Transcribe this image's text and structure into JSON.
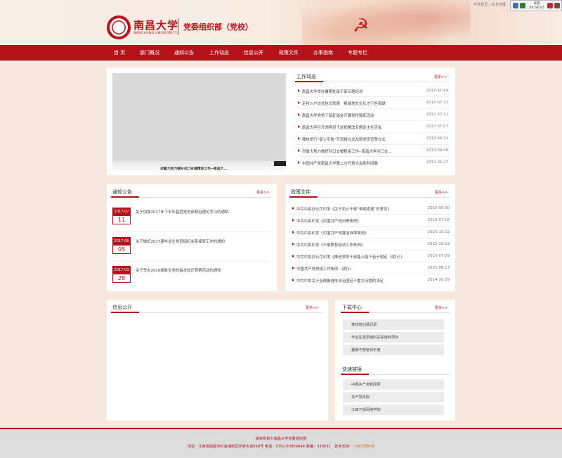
{
  "header": {
    "toplinks": [
      "学校首页",
      "后台管理"
    ],
    "clock_label": "日历",
    "clock_time": "04:58:57",
    "logo_cn": "南昌大学",
    "logo_en": "NANCHANG UNIVERSITY",
    "dept_title": "党委组织部（党校）"
  },
  "nav": [
    "首 页",
    "部门概况",
    "通知公告",
    "工作动态",
    "信息公开",
    "政策文件",
    "办事指南",
    "专题专栏"
  ],
  "more_label": "更多>>",
  "slideshow": {
    "caption": "对暑大努力做好对口支援精金工作--南昌大..."
  },
  "work_news": {
    "title": "工作动态",
    "items": [
      {
        "text": "南昌大学举办暑期处级干部专题培训",
        "date": "2017-07-14"
      },
      {
        "text": "走村入户访贫挂识民情　精准扶贫见长才干担责献",
        "date": "2017-07-11"
      },
      {
        "text": "南昌大学党务干部赴瑞金开展党性锻炼活动",
        "date": "2017-07-11"
      },
      {
        "text": "南昌大学召开领导班子巡视整改专题民主生活会",
        "date": "2017-07-07"
      },
      {
        "text": "我校举行“星火引航”开班授仪式及新党员宣誓仪式",
        "date": "2017-06-21"
      },
      {
        "text": "尽最大努力做好对口支援精金工作--南昌大学对口支...",
        "date": "2017-06-06"
      },
      {
        "text": "中国共产党南昌大学第二次代表大会胜利闭幕",
        "date": "2017-05-27"
      }
    ]
  },
  "notices": {
    "title": "通知公告",
    "items": [
      {
        "ym": "2017-07",
        "day": "11",
        "text": "关于加强2017年下半年基层党支部政治理论学习的通知"
      },
      {
        "ym": "2017-06",
        "day": "05",
        "text": "关于做好2017届毕业生党员组织关系接转工作的通知"
      },
      {
        "ym": "2017-03",
        "day": "28",
        "text": "关于举办2016级新生党的基本知识竞赛活动的通知"
      }
    ]
  },
  "policies": {
    "title": "政策文件",
    "items": [
      {
        "text": "中共中央办公厅印发《关于防止干部“带病提拔”的意见》",
        "date": "2016-08-30"
      },
      {
        "text": "中共中央印发《中国共产党问责条例》",
        "date": "2016-07-18"
      },
      {
        "text": "中共中央印发《中国共产党廉洁自律准则》",
        "date": "2015-10-22"
      },
      {
        "text": "中共中央印发《干部教育培训工作条例》",
        "date": "2015-10-19"
      },
      {
        "text": "中共中央办公厅印发《推进领导干部能上能下若干规定（试行）》",
        "date": "2015-07-29"
      },
      {
        "text": "中国共产党党组工作条例（试行）",
        "date": "2015-06-17"
      },
      {
        "text": "中共中央关于全面推进依法治国若干重大问题的决定",
        "date": "2014-10-29"
      }
    ]
  },
  "info_public": {
    "title": "信息公开"
  },
  "downloads": {
    "title": "下载中心",
    "items": [
      "党校培训通讯录",
      "毕业生党员组织关系接转须知",
      "暑期干部培训手册"
    ]
  },
  "links": {
    "title": "快速链接",
    "items": [
      "中国共产党新闻网",
      "共产党员网",
      "江西干部网络学院"
    ]
  },
  "footer": {
    "copyright": "版权所有©南昌大学党委组织部",
    "address": "地址：江西省南昌市红谷滩新区学府大道999号 电话：0791-83969046 邮编：330031　技术支持：",
    "support": "江西华网科技"
  }
}
